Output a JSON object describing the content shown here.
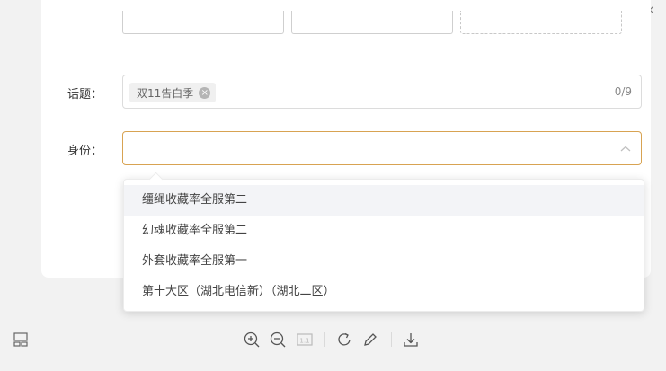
{
  "form": {
    "topic": {
      "label": "话题：",
      "tag": "双11告白季",
      "counter": "0/9"
    },
    "identity": {
      "label": "身份：",
      "value": ""
    }
  },
  "dropdown": {
    "options": [
      "缰绳收藏率全服第二",
      "幻魂收藏率全服第二",
      "外套收藏率全服第一",
      "第十大区（湖北电信新）（湖北二区）"
    ],
    "hovered_index": 0
  },
  "toolbar": {
    "icons": [
      "layout-icon",
      "zoom-in-icon",
      "zoom-out-icon",
      "actual-size-icon",
      "rotate-icon",
      "edit-icon",
      "download-icon"
    ],
    "actual_size_label": "1:1"
  },
  "colors": {
    "focus_border": "#d8a352",
    "background": "#f2f2f2"
  }
}
